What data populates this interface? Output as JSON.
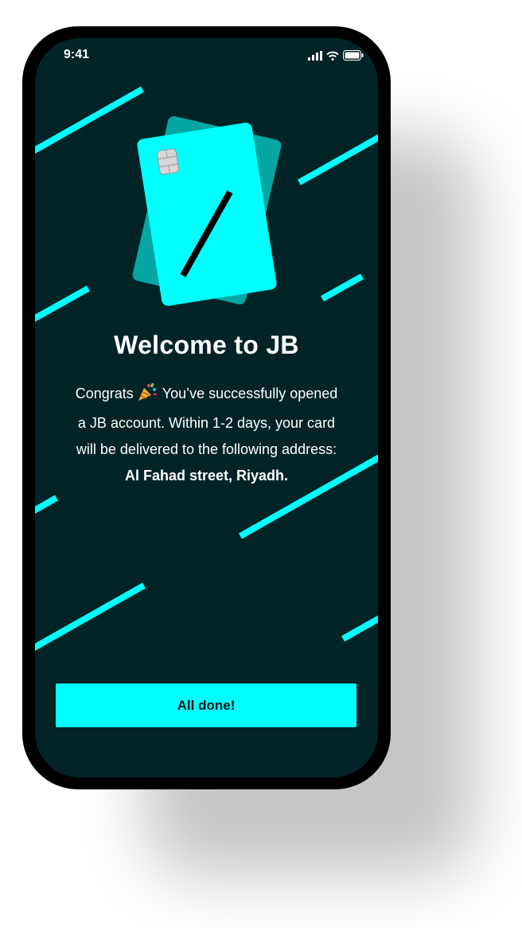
{
  "status_bar": {
    "time": "9:41",
    "icons": [
      "signal-icon",
      "wifi-icon",
      "battery-icon"
    ]
  },
  "hero": {
    "icon": "credit-card-icon"
  },
  "welcome": {
    "title": "Welcome to JB",
    "line1_before": "Congrats",
    "party_icon": "party-popper-icon",
    "line1_after": "You’ve successfully opened",
    "line2": "a JB account. Within 1-2 days, your card",
    "line3": "will be delivered to the following address:",
    "address": "Al Fahad street, Riyadh."
  },
  "actions": {
    "done_label": "All done!"
  },
  "colors": {
    "background": "#022427",
    "accent": "#00ffff",
    "card_back": "#05a6a3",
    "text": "#ffffff"
  }
}
